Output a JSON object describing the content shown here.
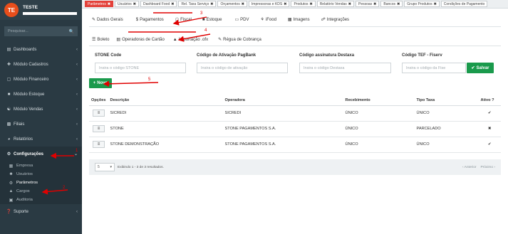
{
  "brand": {
    "initials": "TE",
    "name": "TESTE"
  },
  "sidebar": {
    "search_placeholder": "Pesquisar...",
    "items": [
      {
        "label": "Dashboards"
      },
      {
        "label": "Módulo Cadastros"
      },
      {
        "label": "Módulo Financeiro"
      },
      {
        "label": "Módulo Estoque"
      },
      {
        "label": "Módulo Vendas"
      },
      {
        "label": "Filiais"
      },
      {
        "label": "Relatórios"
      },
      {
        "label": "Configurações"
      },
      {
        "label": "Suporte"
      }
    ],
    "subitems": [
      {
        "label": "Empresa"
      },
      {
        "label": "Usuários"
      },
      {
        "label": "Parâmetros"
      },
      {
        "label": "Cargos"
      },
      {
        "label": "Auditoria"
      }
    ]
  },
  "top_tabs": [
    "Parâmetros",
    "Usuários",
    "Dashboard Food",
    "Rel. Taxa Serviço",
    "Orçamentos",
    "Impressoras e KDS",
    "Produtos",
    "Relatório Vendas",
    "Pessoas",
    "Bancos",
    "Grupo Produtos",
    "Condições de Pagamento"
  ],
  "subnav_row1": [
    "Dados Gerais",
    "Pagamentos",
    "Fiscal",
    "Estoque",
    "PDV",
    "iFood",
    "Imagens",
    "Integrações"
  ],
  "subnav_row2": [
    "Boleto",
    "Operadoras de Cartão",
    "Importação .ofx",
    "Régua de Cobrança"
  ],
  "form": {
    "stone_label": "STONE Code",
    "stone_placeholder": "Insira o código STONE",
    "pagbank_label": "Código de Ativação PagBank",
    "pagbank_placeholder": "Insira o código de ativação",
    "destaxa_label": "Código assinatura Destaxa",
    "destaxa_placeholder": "Insira o código Destaxa",
    "fiserv_label": "Código TEF - Fiserv",
    "fiserv_placeholder": "Insira o código da Fise",
    "save_label": "Salvar",
    "new_label": "Novo"
  },
  "table": {
    "headers": [
      "Opções",
      "Descrição",
      "Operadora",
      "Recebimento",
      "Tipo Taxa",
      "Ativo ?"
    ],
    "rows": [
      {
        "descricao": "SICREDI",
        "operadora": "SICREDI",
        "recebimento": "ÚNICO",
        "tipo_taxa": "ÚNICO",
        "ativo": "✔"
      },
      {
        "descricao": "STONE",
        "operadora": "STONE PAGAMENTOS S.A.",
        "recebimento": "ÚNICO",
        "tipo_taxa": "PARCELADO",
        "ativo": "✖"
      },
      {
        "descricao": "STONE DEMONSTRAÇÃO",
        "operadora": "STONE PAGAMENTOS S.A.",
        "recebimento": "ÚNICO",
        "tipo_taxa": "ÚNICO",
        "ativo": "✔"
      }
    ]
  },
  "pagination": {
    "page_size": "5",
    "info": "Exibindo 1 - 3 de 3 resultados.",
    "prev": "‹ Anterior",
    "next": "Próximo ›"
  },
  "annotations": [
    "1",
    "2",
    "3",
    "4",
    "5"
  ],
  "colors": {
    "accent_red": "#e3413a",
    "sidebar_bg": "#2a3a43",
    "green": "#1a9a4c",
    "annotation_red": "#e00000"
  }
}
